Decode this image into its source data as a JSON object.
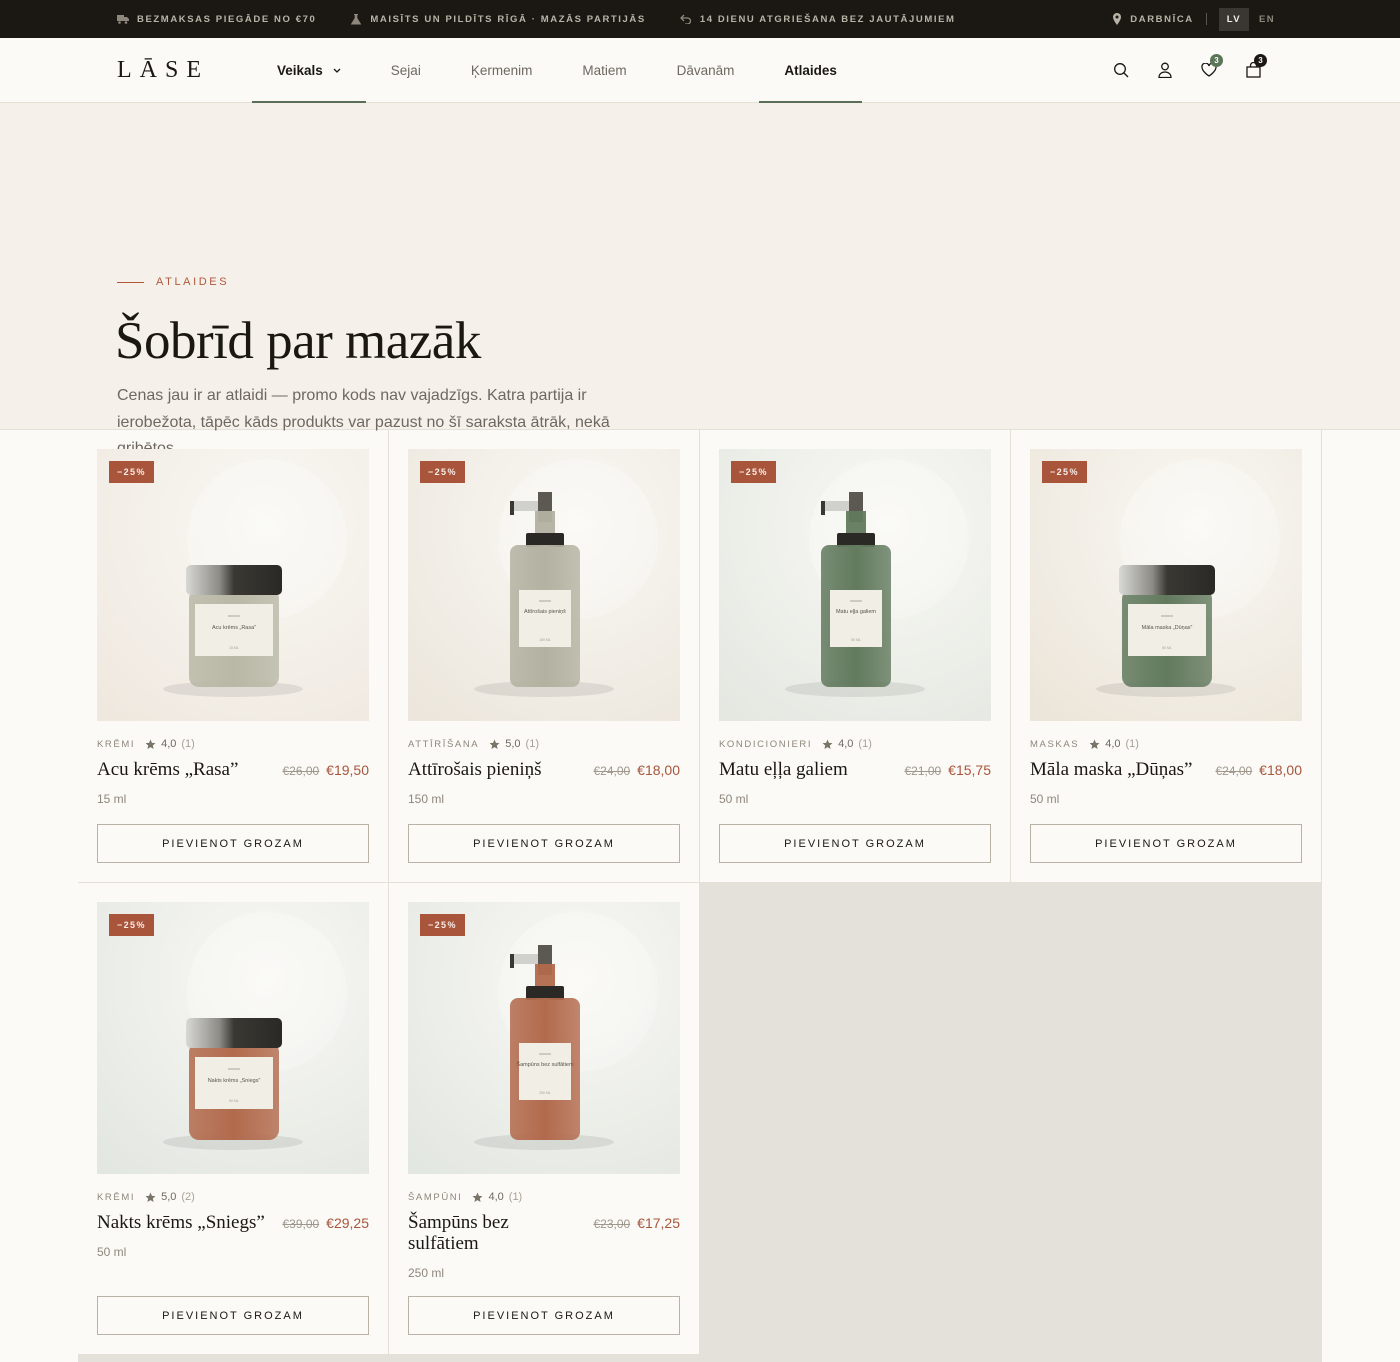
{
  "topbar": {
    "items": [
      {
        "icon": "truck-icon",
        "text": "Bezmaksas piegāde no €70"
      },
      {
        "icon": "flask-icon",
        "text": "Maisīts un pildīts Rīgā · mazās partijās"
      },
      {
        "icon": "return-arrow-icon",
        "text": "14 dienu atgriešana bez jautājumiem"
      }
    ],
    "location": "Darbnīca",
    "lang_active": "LV",
    "lang_other": "EN"
  },
  "header": {
    "logo": "LĀSE",
    "nav": [
      {
        "label": "Veikals",
        "dropdown": true
      },
      {
        "label": "Sejai"
      },
      {
        "label": "Ķermenim"
      },
      {
        "label": "Matiem"
      },
      {
        "label": "Dāvanām"
      },
      {
        "label": "Atlaides",
        "active": true
      }
    ],
    "wishlist_count": "3",
    "cart_count": "3"
  },
  "hero": {
    "eyebrow": "ATLAIDES",
    "title": "Šobrīd par mazāk",
    "description": "Cenas jau ir ar atlaidi — promo kods nav vajadzīgs. Katra partija ir ierobežota, tāpēc kāds produkts var pazust no šī saraksta ātrāk, nekā gribētos."
  },
  "colors": {
    "accent": "#a9553c",
    "green": "#5b7557",
    "dark": "#1b1814"
  },
  "products": [
    {
      "discount": "−25%",
      "category": "Krēmi",
      "rating": "4,0",
      "reviews": "(1)",
      "name": "Acu krēms „Rasa”",
      "old_price": "€26,00",
      "price": "€19,50",
      "volume": "15 ml",
      "button": "PIEVIENOT GROZAM",
      "label": "Acu krēms „Rasa”",
      "label_vol": "15 ML",
      "type": "jar",
      "body_color": "#b9b8a6",
      "bg": "#efe8df"
    },
    {
      "discount": "−25%",
      "category": "Attīrīšana",
      "rating": "5,0",
      "reviews": "(1)",
      "name": "Attīrošais pieniņš",
      "old_price": "€24,00",
      "price": "€18,00",
      "volume": "150 ml",
      "button": "PIEVIENOT GROZAM",
      "label": "Attīrošais pieniņš",
      "label_vol": "150 ML",
      "type": "bottle",
      "body_color": "#b3b2a1",
      "bg": "#ece6dc"
    },
    {
      "discount": "−25%",
      "category": "Kondicionieri",
      "rating": "4,0",
      "reviews": "(1)",
      "name": "Matu eļļa galiem",
      "old_price": "€21,00",
      "price": "€15,75",
      "volume": "50 ml",
      "button": "PIEVIENOT GROZAM",
      "label": "Matu eļļa galiem",
      "label_vol": "50 ML",
      "type": "bottle",
      "body_color": "#627a5e",
      "bg": "#e4e8e1"
    },
    {
      "discount": "−25%",
      "category": "Maskas",
      "rating": "4,0",
      "reviews": "(1)",
      "name": "Māla maska „Dūņas”",
      "old_price": "€24,00",
      "price": "€18,00",
      "volume": "50 ml",
      "button": "PIEVIENOT GROZAM",
      "label": "Māla maska „Dūņas”",
      "label_vol": "50 ML",
      "type": "jar",
      "body_color": "#627a5e",
      "bg": "#ece5d9"
    },
    {
      "discount": "−25%",
      "category": "Krēmi",
      "rating": "5,0",
      "reviews": "(2)",
      "name": "Nakts krēms „Sniegs”",
      "old_price": "€39,00",
      "price": "€29,25",
      "volume": "50 ml",
      "button": "PIEVIENOT GROZAM",
      "label": "Nakts krēms „Sniegs”",
      "label_vol": "50 ML",
      "type": "jar",
      "body_color": "#b26a4c",
      "bg": "#e3e7e1"
    },
    {
      "discount": "−25%",
      "category": "Šampūni",
      "rating": "4,0",
      "reviews": "(1)",
      "name": "Šampūns bez sulfātiem",
      "old_price": "€23,00",
      "price": "€17,25",
      "volume": "250 ml",
      "button": "PIEVIENOT GROZAM",
      "label": "Šampūns bez sulfātiem",
      "label_vol": "250 ML",
      "type": "bottle",
      "body_color": "#b26a4c",
      "bg": "#e3e7e1"
    }
  ]
}
